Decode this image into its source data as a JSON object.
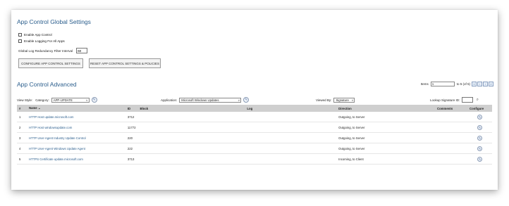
{
  "global": {
    "title": "App Control Global Settings",
    "enable_app_control": "Enable App Control",
    "enable_logging": "Enable Logging For All Apps",
    "interval_label": "Global Log Redundancy Filter Interval",
    "interval_value": "60",
    "configure_btn": "CONFIGURE APP CONTROL SETTINGS",
    "reset_btn": "RESET APP CONTROL SETTINGS & POLICIES"
  },
  "advanced": {
    "title": "App Control Advanced",
    "items_label": "Items",
    "items_value": "1",
    "items_range": "to 5 (of 5)",
    "view_style": "View Style:",
    "category_label": "Category:",
    "category_value": "APP-UPDATE",
    "application_label": "Application:",
    "application_value": "Microsoft Windows Updates",
    "viewed_by_label": "Viewed By:",
    "viewed_by_value": "Signature",
    "lookup_label": "Lookup Signature ID:"
  },
  "table": {
    "headers": {
      "num": "#",
      "name": "Name",
      "sort": "⌄",
      "id": "ID",
      "block": "Block",
      "log": "Log",
      "direction": "Direction",
      "comments": "Comments",
      "configure": "Configure"
    },
    "rows": [
      {
        "num": "1",
        "name": "HTTP Host update.microsoft.com",
        "id": "3712",
        "direction": "Outgoing, to Server"
      },
      {
        "num": "2",
        "name": "HTTP Host windowsupdate.com",
        "id": "11772",
        "direction": "Outgoing, to Server"
      },
      {
        "num": "3",
        "name": "HTTP User-Agent Industry Update Control",
        "id": "220",
        "direction": "Outgoing, to Server"
      },
      {
        "num": "4",
        "name": "HTTP User-Agent Windows Update Agent",
        "id": "222",
        "direction": "Outgoing, to Server"
      },
      {
        "num": "5",
        "name": "HTTPS Certificate update.microsoft.com",
        "id": "3713",
        "direction": "Incoming, to Client"
      }
    ]
  },
  "icons": {
    "edit": "✎",
    "dropdown": "∨",
    "first": "«",
    "prev": "‹",
    "next": "›",
    "last": "»",
    "lookup": "⌕"
  },
  "colors": {
    "accent": "#2a5d8c",
    "header_bg": "#cfcfcf"
  }
}
